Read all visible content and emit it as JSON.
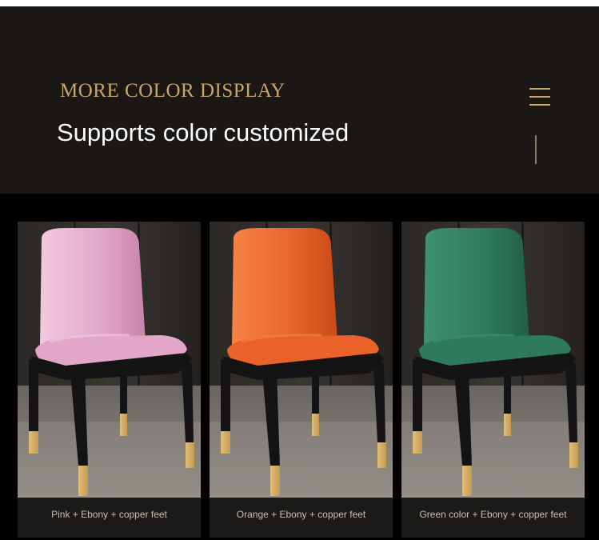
{
  "header": {
    "title": "MORE COLOR DISPLAY",
    "subtitle": "Supports color customized"
  },
  "products": [
    {
      "caption": "Pink + Ebony + copper feet",
      "seat_color": "#e2a6c8",
      "seat_shade": "#c783ab",
      "seat_light": "#f3c8df"
    },
    {
      "caption": "Orange + Ebony + copper feet",
      "seat_color": "#e8622a",
      "seat_shade": "#c94a18",
      "seat_light": "#f48447"
    },
    {
      "caption": "Green color + Ebony + copper feet",
      "seat_color": "#2f7a5c",
      "seat_shade": "#225e46",
      "seat_light": "#3f9170"
    }
  ],
  "colors": {
    "accent_gold": "#c9a56b",
    "header_bg": "#1a1715",
    "frame_ebony": "#141414",
    "copper": "#c49a52"
  },
  "icons": [
    "menu-icon"
  ]
}
